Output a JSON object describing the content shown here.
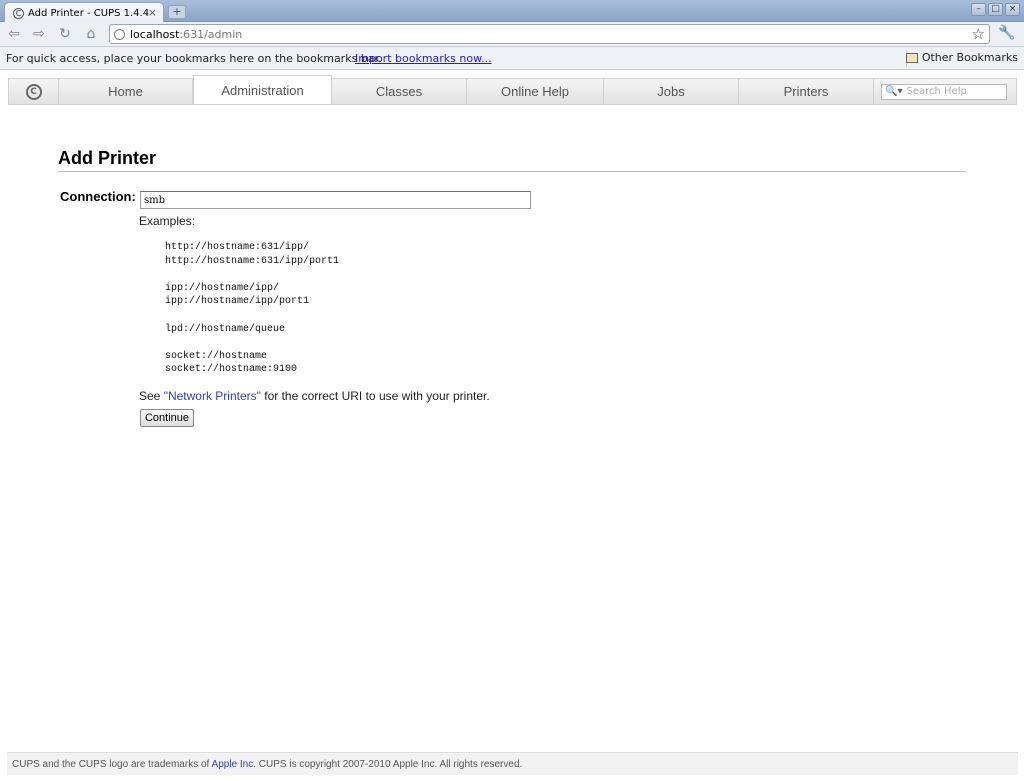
{
  "browser": {
    "tab_title": "Add Printer - CUPS 1.4.4",
    "url_host": "localhost",
    "url_rest": ":631/admin",
    "bookmarks_prompt": "For quick access, place your bookmarks here on the bookmarks bar.",
    "import_link": "Import bookmarks now...",
    "other_bookmarks": "Other Bookmarks"
  },
  "nav": {
    "items": [
      "Home",
      "Administration",
      "Classes",
      "Online Help",
      "Jobs",
      "Printers"
    ],
    "active": "Administration",
    "search_placeholder": "Search Help"
  },
  "page": {
    "title": "Add Printer",
    "connection_label": "Connection:",
    "connection_value": "smb",
    "examples_label": "Examples:",
    "examples": [
      [
        "http://hostname:631/ipp/",
        "http://hostname:631/ipp/port1"
      ],
      [
        "ipp://hostname/ipp/",
        "ipp://hostname/ipp/port1"
      ],
      [
        "lpd://hostname/queue"
      ],
      [
        "socket://hostname",
        "socket://hostname:9100"
      ]
    ],
    "see_prefix": "See ",
    "see_link": "\"Network Printers\"",
    "see_suffix": " for the correct URI to use with your printer.",
    "continue_label": "Continue"
  },
  "footer": {
    "prefix": "CUPS and the CUPS logo are trademarks of ",
    "link": "Apple Inc.",
    "suffix": " CUPS is copyright 2007-2010 Apple Inc. All rights reserved."
  }
}
